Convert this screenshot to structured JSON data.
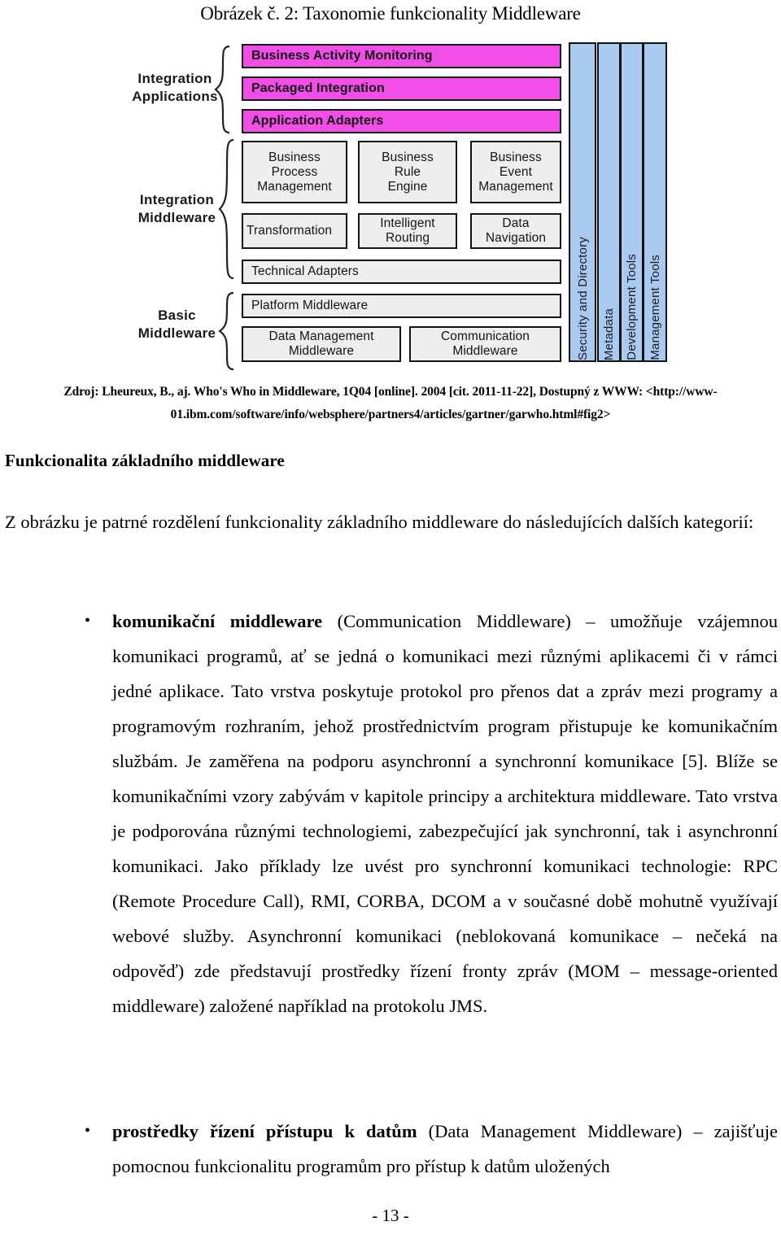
{
  "figure": {
    "caption": "Obrázek č. 2: Taxonomie funkcionality Middleware",
    "colors": {
      "magenta": "#f14ee8",
      "grey": "#eeeeee",
      "blue": "#a9c9ef",
      "border": "#121212"
    },
    "tiers": [
      {
        "label_line1": "Integration",
        "label_line2": "Applications",
        "boxes": [
          "Business Activity Monitoring",
          "Packaged Integration",
          "Application Adapters"
        ]
      },
      {
        "label_line1": "Integration",
        "label_line2": "Middleware",
        "boxes_row1": [
          {
            "l1": "Business",
            "l2": "Process",
            "l3": "Management"
          },
          {
            "l1": "Business",
            "l2": "Rule",
            "l3": "Engine"
          },
          {
            "l1": "Business",
            "l2": "Event",
            "l3": "Management"
          }
        ],
        "boxes_row2": [
          {
            "l1": "Transformation",
            "l2": ""
          },
          {
            "l1": "Intelligent",
            "l2": "Routing"
          },
          {
            "l1": "Data",
            "l2": "Navigation"
          }
        ],
        "boxes_row3": [
          "Technical Adapters"
        ]
      },
      {
        "label_line1": "Basic",
        "label_line2": "Middleware",
        "boxes_row1": [
          "Platform Middleware"
        ],
        "boxes_row2": [
          {
            "l1": "Data Management",
            "l2": "Middleware"
          },
          {
            "l1": "Communication",
            "l2": "Middleware"
          }
        ]
      }
    ],
    "vertical_columns": [
      "Security and Directory",
      "Metadata",
      "Development Tools",
      "Management Tools"
    ]
  },
  "source": {
    "label": "Zdroj",
    "line1": ": Lheureux, B., aj. Who's Who in Middleware, 1Q04 [online]. 2004 [cit. 2011-11-22], Dostupný z WWW: <http://www-",
    "line2": "01.ibm.com/software/info/websphere/partners4/articles/gartner/garwho.html#fig2>"
  },
  "body": {
    "heading": "Funkcionalita základního middleware",
    "intro": "Z obrázku je patrné rozdělení funkcionality základního middleware do následujících dalších kategorií:",
    "bullets": [
      {
        "marker": "•",
        "bold": "komunikační middleware",
        "rest": " (Communication Middleware) – umožňuje vzájemnou komunikaci programů, ať se jedná o komunikaci mezi různými aplikacemi či v rámci jedné aplikace. Tato vrstva poskytuje protokol pro přenos dat a zpráv mezi programy a programovým rozhraním, jehož prostřednictvím program přistupuje ke komunikačním službám. Je zaměřena na podporu asynchronní a synchronní komunikace [5]. Blíže se komunikačními vzory zabývám v kapitole principy a architektura middleware.  Tato vrstva je podporována různými technologiemi, zabezpečující jak synchronní, tak i asynchronní komunikaci. Jako příklady lze uvést pro synchronní komunikaci technologie: RPC (Remote Procedure Call), RMI, CORBA, DCOM a v současné době mohutně využívají webové služby. Asynchronní komunikaci (neblokovaná komunikace – nečeká na odpověď) zde představují prostředky řízení fronty zpráv (MOM – message-oriented middleware) založené například na protokolu JMS."
      },
      {
        "marker": "•",
        "bold": "prostředky řízení přístupu k datům",
        "rest": " (Data Management Middleware) – zajišťuje pomocnou funkcionalitu programům pro přístup k datům uložených"
      }
    ]
  },
  "footer": {
    "page_number": "- 13 -"
  }
}
